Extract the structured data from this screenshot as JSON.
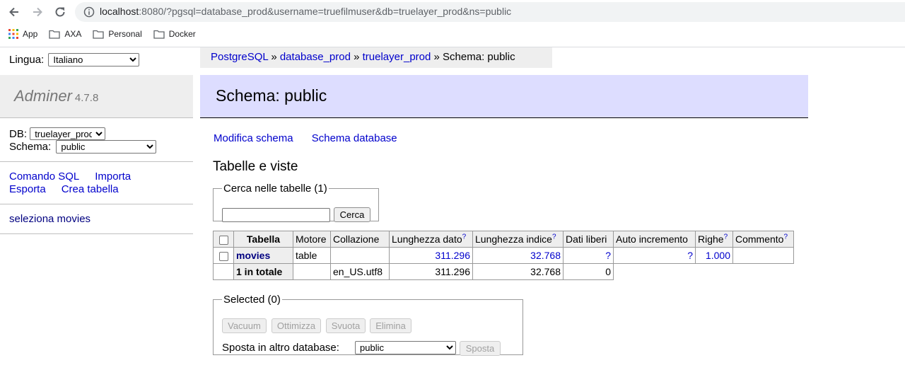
{
  "browser": {
    "url_host": "localhost",
    "url_rest": ":8080/?pgsql=database_prod&username=truefilmuser&db=truelayer_prod&ns=public",
    "bookmarks": [
      {
        "label": "App",
        "icon": "apps-grid-icon"
      },
      {
        "label": "AXA",
        "icon": "folder-icon"
      },
      {
        "label": "Personal",
        "icon": "folder-icon"
      },
      {
        "label": "Docker",
        "icon": "folder-icon"
      }
    ]
  },
  "menu": {
    "lang_label": "Lingua:",
    "lang_value": "Italiano",
    "app_name": "Adminer",
    "version": "4.7.8",
    "db_label": "DB:",
    "db_value": "truelayer_prod",
    "schema_label": "Schema:",
    "schema_value": "public",
    "links": [
      "Comando SQL",
      "Importa",
      "Esporta",
      "Crea tabella"
    ],
    "table_link": "seleziona movies"
  },
  "breadcrumb": {
    "items": [
      "PostgreSQL",
      "database_prod",
      "truelayer_prod"
    ],
    "sep": "»",
    "current": "Schema: public"
  },
  "page": {
    "title": "Schema: public",
    "links": [
      "Modifica schema",
      "Schema database"
    ],
    "section_title": "Tabelle e viste",
    "search_legend": "Cerca nelle tabelle (1)",
    "search_button": "Cerca",
    "selected_legend": "Selected (0)",
    "action_buttons": [
      "Vacuum",
      "Ottimizza",
      "Svuota",
      "Elimina"
    ],
    "move_label": "Sposta in altro database:",
    "move_value": "public",
    "move_button": "Sposta"
  },
  "table": {
    "headers": {
      "tabella": "Tabella",
      "motore": "Motore",
      "collazione": "Collazione",
      "lunghezza_dato": "Lunghezza dato",
      "lunghezza_indice": "Lunghezza indice",
      "dati_liberi": "Dati liberi",
      "auto_incremento": "Auto incremento",
      "righe": "Righe",
      "commento": "Commento"
    },
    "help_mark": "?",
    "row": {
      "name": "movies",
      "engine": "table",
      "collation": "",
      "data_length": "311.296",
      "index_length": "32.768",
      "free": "?",
      "auto_inc": "?",
      "rows": "1.000",
      "comment": ""
    },
    "total": {
      "label": "1 in totale",
      "collation": "en_US.utf8",
      "data_length": "311.296",
      "index_length": "32.768",
      "free": "0"
    }
  },
  "colors": {
    "link": "#0000cc",
    "header_bg": "#ddddff",
    "panel_bg": "#eeeeee"
  }
}
